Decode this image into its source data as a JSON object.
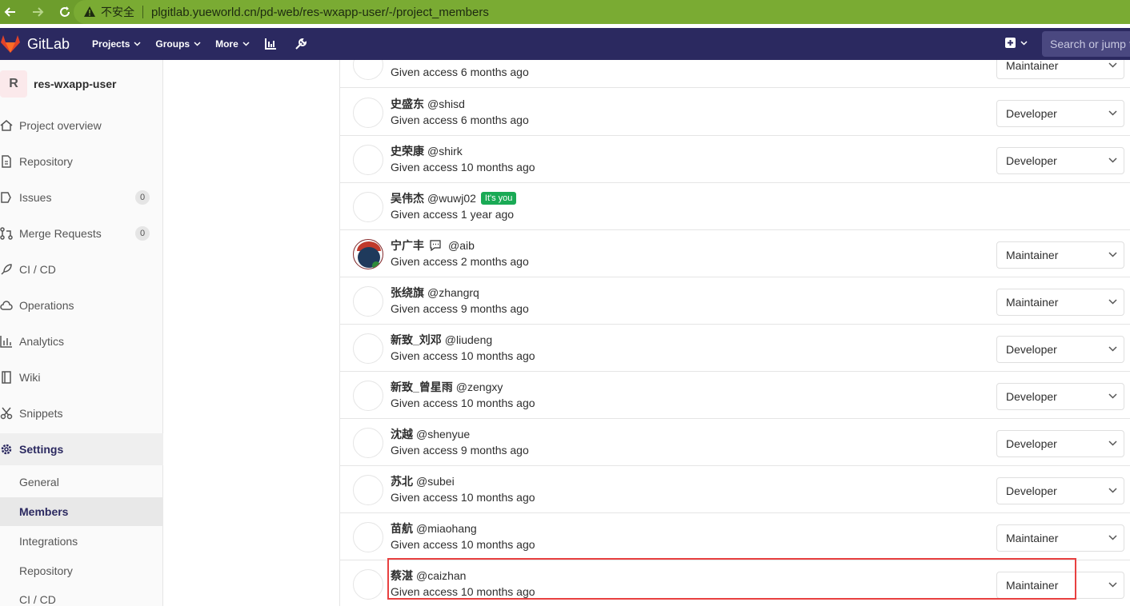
{
  "browser": {
    "insecure_label": "不安全",
    "url": "plgitlab.yueworld.cn/pd-web/res-wxapp-user/-/project_members"
  },
  "header": {
    "brand": "GitLab",
    "menus": [
      "Projects",
      "Groups",
      "More"
    ],
    "search_placeholder": "Search or jump to…"
  },
  "sidebar": {
    "project_initial": "R",
    "project_name": "res-wxapp-user",
    "items": [
      {
        "label": "Project overview"
      },
      {
        "label": "Repository"
      },
      {
        "label": "Issues",
        "count": "0"
      },
      {
        "label": "Merge Requests",
        "count": "0"
      },
      {
        "label": "CI / CD"
      },
      {
        "label": "Operations"
      },
      {
        "label": "Analytics"
      },
      {
        "label": "Wiki"
      },
      {
        "label": "Snippets"
      },
      {
        "label": "Settings"
      }
    ],
    "settings_sub": [
      "General",
      "Members",
      "Integrations",
      "Repository",
      "CI / CD"
    ]
  },
  "members": [
    {
      "name": "",
      "username": "",
      "access": "Given access 6 months ago",
      "role": "Maintainer"
    },
    {
      "name": "史盛东",
      "username": "@shisd",
      "access": "Given access 6 months ago",
      "role": "Developer"
    },
    {
      "name": "史荣康",
      "username": "@shirk",
      "access": "Given access 10 months ago",
      "role": "Developer"
    },
    {
      "name": "吴伟杰",
      "username": "@wuwj02",
      "access": "Given access 1 year ago",
      "role": "",
      "you_badge": "It's you"
    },
    {
      "name": "宁广丰",
      "username": "@aib",
      "access": "Given access 2 months ago",
      "role": "Maintainer"
    },
    {
      "name": "张绕旗",
      "username": "@zhangrq",
      "access": "Given access 9 months ago",
      "role": "Maintainer"
    },
    {
      "name": "新致_刘邓",
      "username": "@liudeng",
      "access": "Given access 10 months ago",
      "role": "Developer"
    },
    {
      "name": "新致_曾星雨",
      "username": "@zengxy",
      "access": "Given access 10 months ago",
      "role": "Developer"
    },
    {
      "name": "沈越",
      "username": "@shenyue",
      "access": "Given access 9 months ago",
      "role": "Developer"
    },
    {
      "name": "苏北",
      "username": "@subei",
      "access": "Given access 10 months ago",
      "role": "Developer"
    },
    {
      "name": "苗航",
      "username": "@miaohang",
      "access": "Given access 10 months ago",
      "role": "Maintainer"
    },
    {
      "name": "蔡湛",
      "username": "@caizhan",
      "access": "Given access 10 months ago",
      "role": "Maintainer"
    }
  ],
  "colors": {
    "header_bg": "#2b2960",
    "browser_bar": "#6d9d2c",
    "you_badge": "#1aaa55",
    "highlight": "#e84040"
  }
}
